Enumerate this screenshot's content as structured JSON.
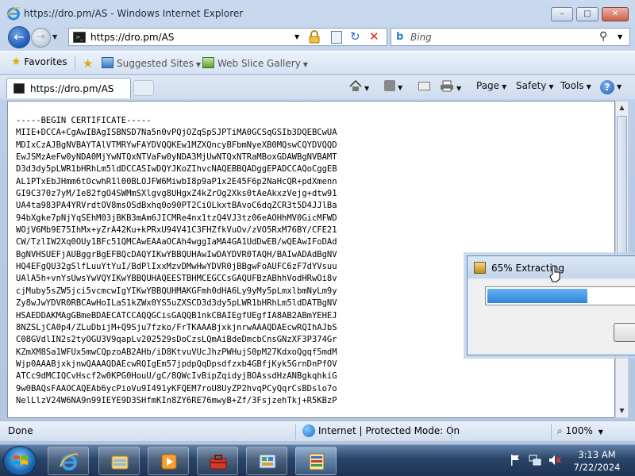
{
  "window": {
    "title": "https://dro.pm/AS - Windows Internet Explorer",
    "minimize_icon": "minimize-icon",
    "maximize_icon": "maximize-icon",
    "close_icon": "close-icon"
  },
  "navigation": {
    "address": "https://dro.pm/AS",
    "search_placeholder": "Bing"
  },
  "favorites_bar": {
    "favorites_label": "Favorites",
    "items": [
      {
        "label": "Suggested Sites",
        "icon": "suggested-sites-icon"
      },
      {
        "label": "Web Slice Gallery",
        "icon": "web-slice-icon"
      }
    ]
  },
  "tab": {
    "label": "https://dro.pm/AS"
  },
  "command_bar": {
    "page_label": "Page",
    "safety_label": "Safety",
    "tools_label": "Tools"
  },
  "content": {
    "certificate_lines": [
      "-----BEGIN CERTIFICATE-----",
      "MIIE+DCCA+CgAwIBAgISBNSD7Na5n0vPQjOZqSpSJPTiMA0GCSqGSIb3DQEBCwUA",
      "MDIxCzAJBgNVBAYTAlVTMRYwFAYDVQQKEw1MZXQncyBFbmNyeXB0MQswCQYDVQQD",
      "EwJSMzAeFw0yNDA0MjYwNTQxNTVaFw0yNDA3MjUwNTQxNTRaMBoxGDAWBgNVBAMT",
      "D3d3dy5pLWR1bHRhLm5ldDCCASIwDQYJKoZIhvcNAQEBBQADggEPADCCAQoCggEB",
      "AL1PTxEbJHmm6tOcwhR1l00BLOJFW6MiwbI8p9aP1x2E45F6p2NaHcQR+pdXmenn",
      "GI9C370z7yM/Ie82fgO4SWMmSXlgvg8UHgxZ4kZrOg2Xks0tAeAkxzVejg+dtw91",
      "UA4ta983PA4YRVrdtOV8msOSdBxhq0o90PT2CiOLkxtBAvoC6dqZCR3t5D4JJlBa",
      "94bXgke7pNjYqSEhM03jBKB3mAm6JICMRe4nx1tzQ4VJ3tz06eAOHhMV0GicMFWD",
      "WOjV6Mb9E75IhMx+yZrA42Ku+kPRxU94V41C3FHZfkVuOv/zVO5RxM76BY/CFE21",
      "CW/TzlIW2Xq0OUy1BFc51QMCAwEAAaOCAh4wggIaMA4GA1UdDwEB/wQEAwIFoDAd",
      "BgNVHSUEFjAUBggrBgEFBQcDAQYIKwYBBQUHAwIwDAYDVR0TAQH/BAIwADAdBgNV",
      "HQ4EFgQU32gSlfLuuYtYuI/BdPlIxxMzvDMwHwYDVR0jBBgwFoAUFC6zF7dYVsuu",
      "UAlA5h+vnYsUwsYwVQYIKwYBBQUHAQEESTBHMCEGCCsGAQUFBzABhhVodHRwOi8v",
      "cjMuby5sZW5jci5vcmcwIgYIKwYBBQUHMAKGFmh0dHA6Ly9yMy5pLmxlbmNyLm9y",
      "Zy8wJwYDVR0RBCAwHoILaS1kZWx0YS5uZXSCD3d3dy5pLWR1bHRhLm5ldDATBgNV",
      "HSAEDDAKMAgGBmeBDAECATCCAQQGCisGAQQB1nkCBAIEgfUEgfIA8AB2ABmYEHEJ",
      "8NZSLjCA0p4/ZLuDbijM+Q9Sju7fzko/FrTKAAABjxkjnrwAAAQDAEcwRQIhAJbS",
      "C08GVdlIN2s2tyOGU3V9qapLv202529sDoCzsLQmAiBdeDmcbCnsGNzXF3P374Gr",
      "KZmXM8Sa1WFUx5mwCQpzoAB2AHb/iD8KtvuVUcJhzPWHujS0pM27KdxoQgqf5mdM",
      "Wjp0AAABjxkjnwQAAAQDAEcwRQIgEm57jpdpQqDpsdfzxb4GBfjKyk5GrnDnPfOV",
      "ATCc9dMCIQCvHscf2w0KPG0HouU/gC/8QWcIvBipZqidyjBOAssdHzANBgkqhkiG",
      "9w0BAQsFAAOCAQEAb6ycPioVu9I491yKFQEM7roU8UyZP2hvqPCyQqrCsBDslo7o",
      "NelLlzV24W6NA9n99IEYE9D3SHfmKIn8ZY6RE76mwyB+Zf/3FsjzehTkj+R5KBzP"
    ]
  },
  "status_bar": {
    "status_text": "Done",
    "zone_text": "Internet | Protected Mode: On",
    "zoom_text": "100%"
  },
  "dialog": {
    "title": "65% Extracting",
    "progress": 0.65
  },
  "taskbar": {
    "items": [
      {
        "icon": "internet-explorer-icon"
      },
      {
        "icon": "windows-explorer-icon"
      },
      {
        "icon": "media-player-icon"
      },
      {
        "icon": "toolbox-icon"
      },
      {
        "icon": "control-panel-icon"
      },
      {
        "icon": "archive-extractor-icon"
      }
    ],
    "time": "3:13 AM",
    "date": "7/22/2024"
  },
  "colors": {
    "progress_fill": "#2d86dc",
    "taskbar": "#2a4467",
    "chrome": "#c9d9ee"
  }
}
